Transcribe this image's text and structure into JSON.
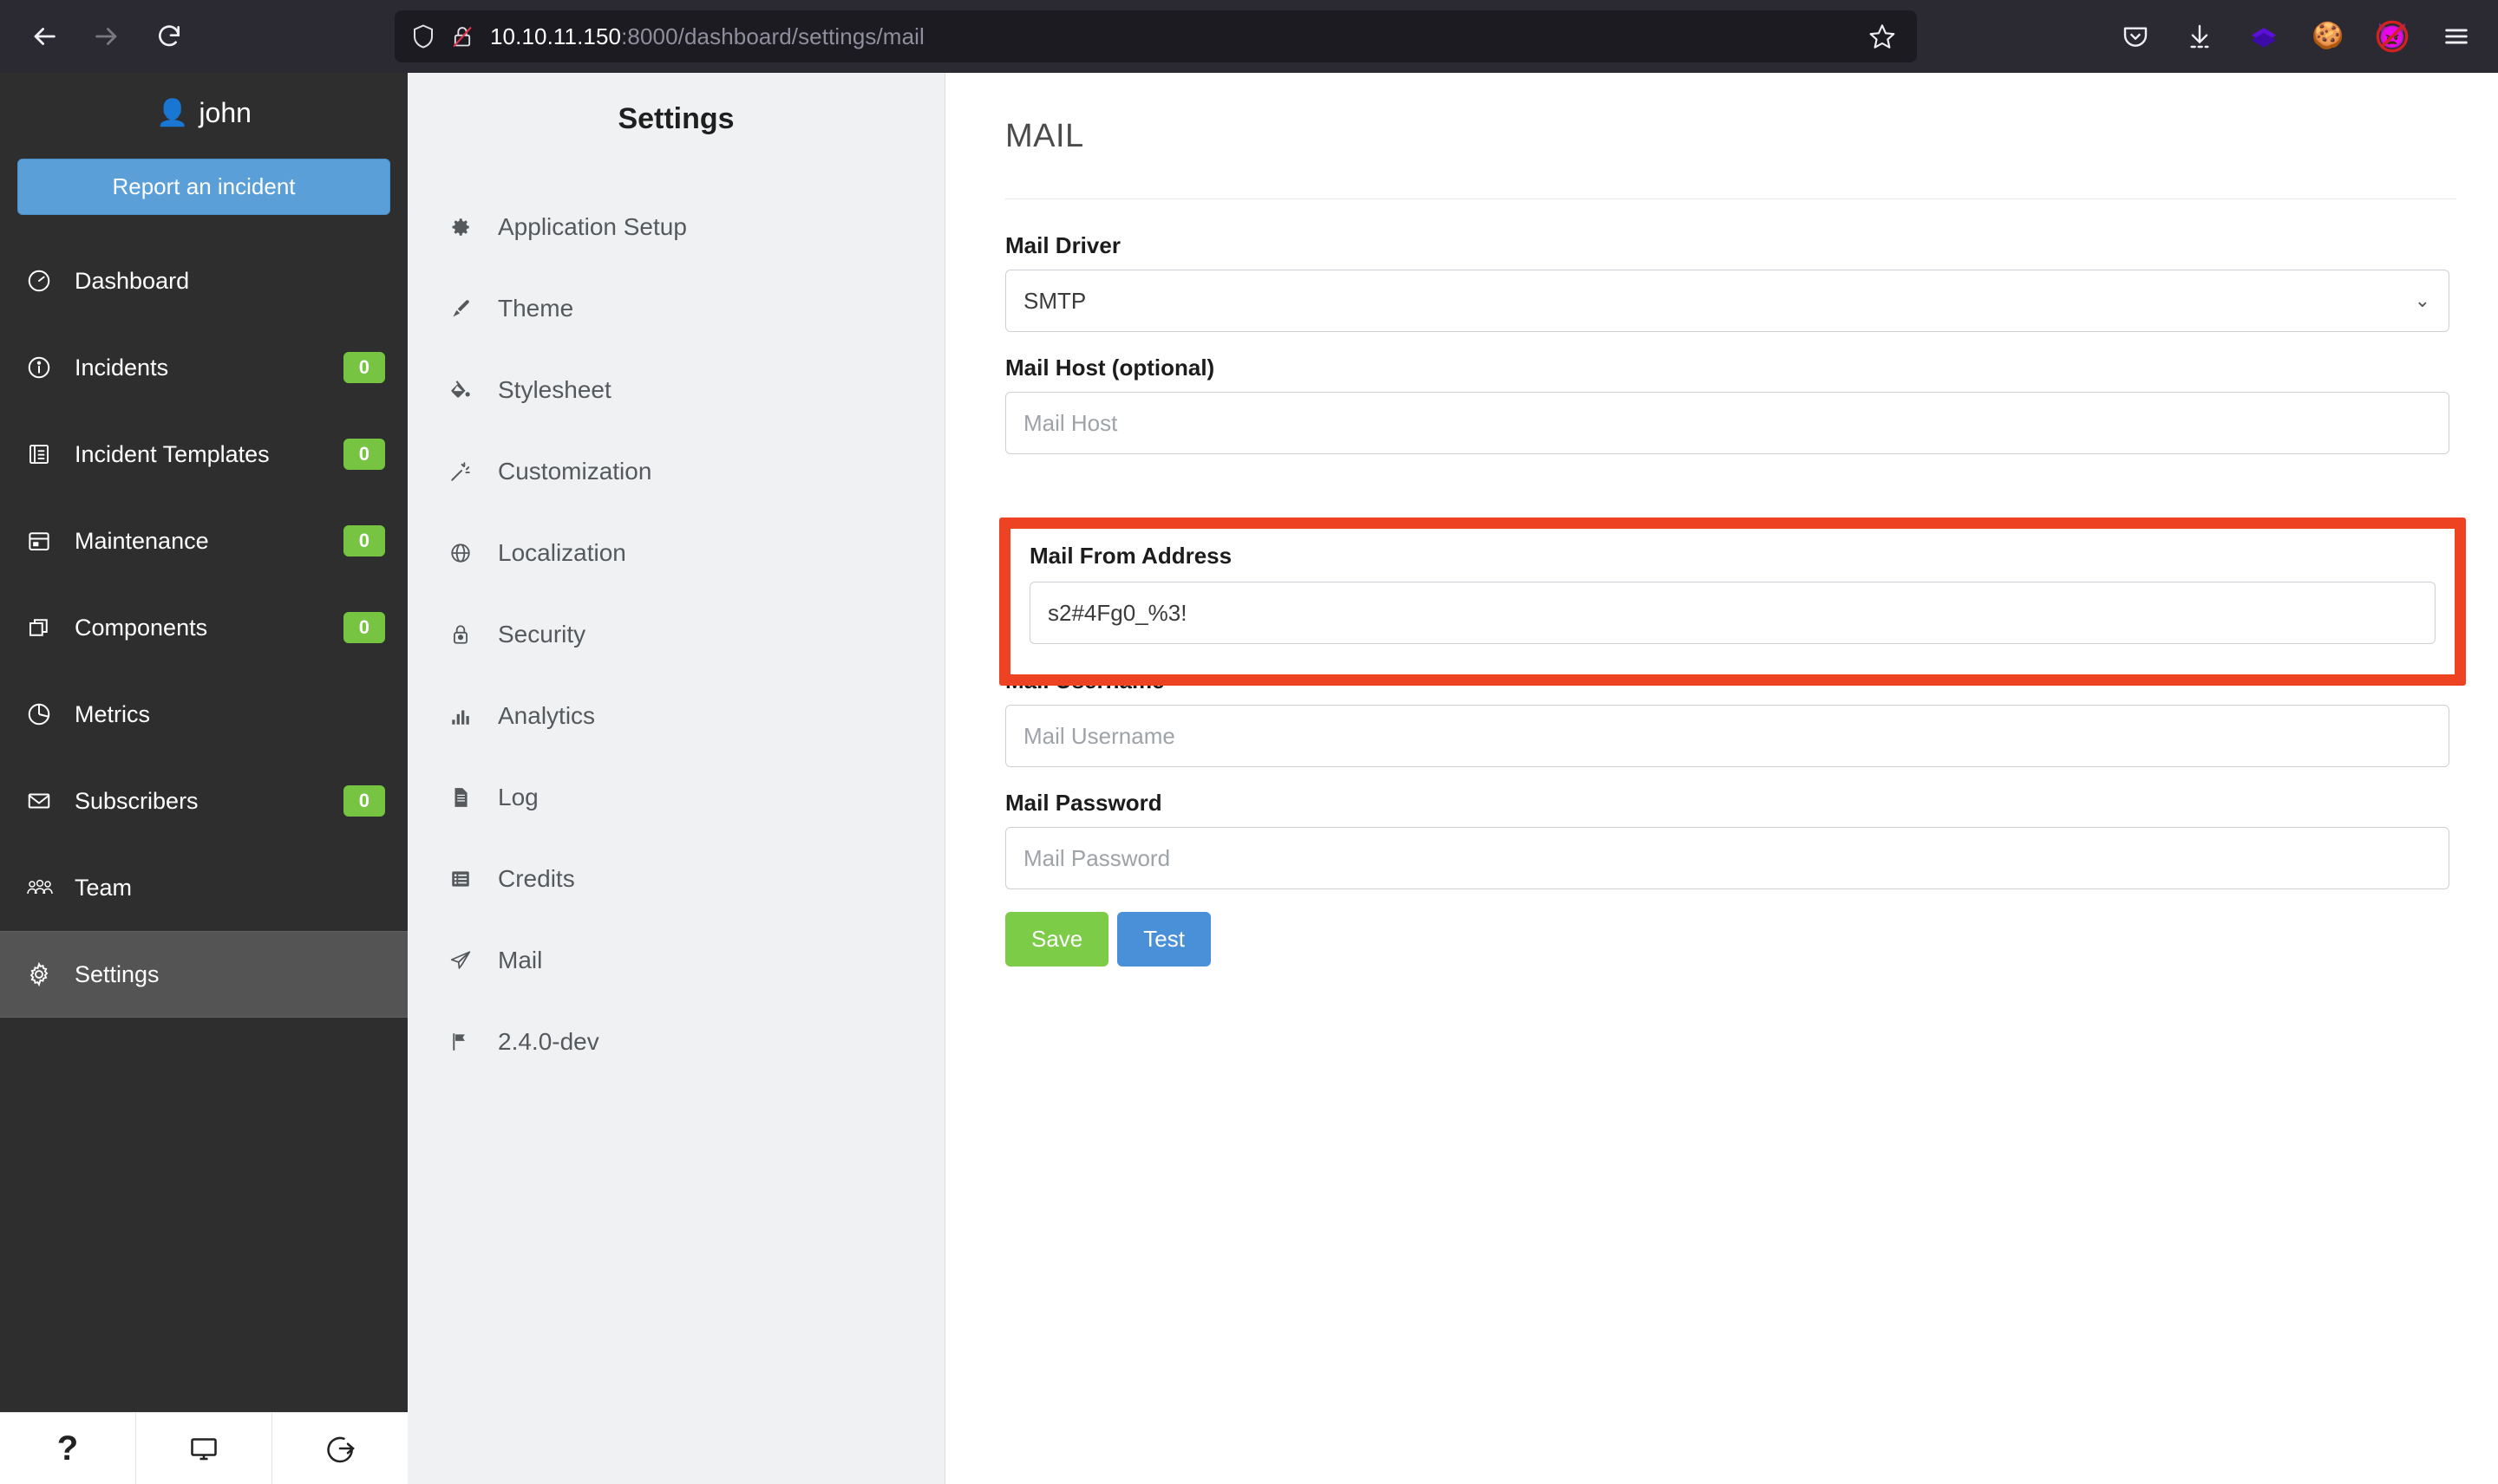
{
  "browser": {
    "back_icon": "arrow-left-icon",
    "forward_icon": "arrow-right-icon",
    "reload_icon": "reload-icon",
    "shield_icon": "shield-icon",
    "insecure_icon": "lock-crossed-icon",
    "url_host": "10.10.11.150",
    "url_path": ":8000/dashboard/settings/mail",
    "bookmark_icon": "star-icon",
    "toolbar_icons": [
      {
        "name": "pocket-icon",
        "glyph": "▽"
      },
      {
        "name": "downloads-icon",
        "glyph": "⬇"
      },
      {
        "name": "extension-diamond-icon",
        "glyph": "◆"
      },
      {
        "name": "cookie-icon",
        "glyph": "🍪"
      },
      {
        "name": "block-devil-icon",
        "glyph": "👿"
      },
      {
        "name": "menu-hamburger-icon",
        "glyph": "☰"
      }
    ]
  },
  "sidebar": {
    "username": "john",
    "user_icon": "person-icon",
    "report_button": "Report an incident",
    "items": [
      {
        "label": "Dashboard",
        "icon": "dashboard-gauge-icon",
        "badge": null,
        "active": false
      },
      {
        "label": "Incidents",
        "icon": "info-circle-icon",
        "badge": "0",
        "active": false
      },
      {
        "label": "Incident Templates",
        "icon": "template-list-icon",
        "badge": "0",
        "active": false
      },
      {
        "label": "Maintenance",
        "icon": "calendar-icon",
        "badge": "0",
        "active": false
      },
      {
        "label": "Components",
        "icon": "layers-square-icon",
        "badge": "0",
        "active": false
      },
      {
        "label": "Metrics",
        "icon": "pie-chart-icon",
        "badge": null,
        "active": false
      },
      {
        "label": "Subscribers",
        "icon": "envelope-icon",
        "badge": "0",
        "active": false
      },
      {
        "label": "Team",
        "icon": "people-group-icon",
        "badge": null,
        "active": false
      },
      {
        "label": "Settings",
        "icon": "gear-icon",
        "badge": null,
        "active": true
      }
    ],
    "bottom_icons": [
      {
        "name": "help-question-icon",
        "glyph": "?"
      },
      {
        "name": "monitor-screen-icon",
        "glyph": "🖥"
      },
      {
        "name": "logout-icon",
        "glyph": "↪"
      }
    ],
    "badge_color": "#76c442",
    "accent_color": "#5a9fd8"
  },
  "settings_panel": {
    "title": "Settings",
    "items": [
      {
        "label": "Application Setup",
        "icon": "gear-icon"
      },
      {
        "label": "Theme",
        "icon": "paintbrush-icon"
      },
      {
        "label": "Stylesheet",
        "icon": "paint-bucket-icon"
      },
      {
        "label": "Customization",
        "icon": "magic-wand-icon"
      },
      {
        "label": "Localization",
        "icon": "globe-icon"
      },
      {
        "label": "Security",
        "icon": "padlock-icon"
      },
      {
        "label": "Analytics",
        "icon": "bar-chart-icon"
      },
      {
        "label": "Log",
        "icon": "document-icon"
      },
      {
        "label": "Credits",
        "icon": "list-icon"
      },
      {
        "label": "Mail",
        "icon": "paper-plane-icon"
      },
      {
        "label": "2.4.0-dev",
        "icon": "flag-icon"
      }
    ]
  },
  "main": {
    "title": "MAIL",
    "fields": {
      "mail_driver": {
        "label": "Mail Driver",
        "value": "SMTP",
        "options": [
          "SMTP"
        ]
      },
      "mail_host": {
        "label": "Mail Host (optional)",
        "value": "",
        "placeholder": "Mail Host"
      },
      "mail_from_address": {
        "label": "Mail From Address",
        "value": "s2#4Fg0_%3!",
        "placeholder": "Mail From Address",
        "highlighted": true,
        "highlight_color": "#ee4322"
      },
      "mail_username": {
        "label": "Mail Username",
        "value": "",
        "placeholder": "Mail Username"
      },
      "mail_password": {
        "label": "Mail Password",
        "value": "",
        "placeholder": "Mail Password"
      }
    },
    "buttons": {
      "save": "Save",
      "test": "Test",
      "save_color": "#7ccc47",
      "test_color": "#4a90d9"
    }
  }
}
